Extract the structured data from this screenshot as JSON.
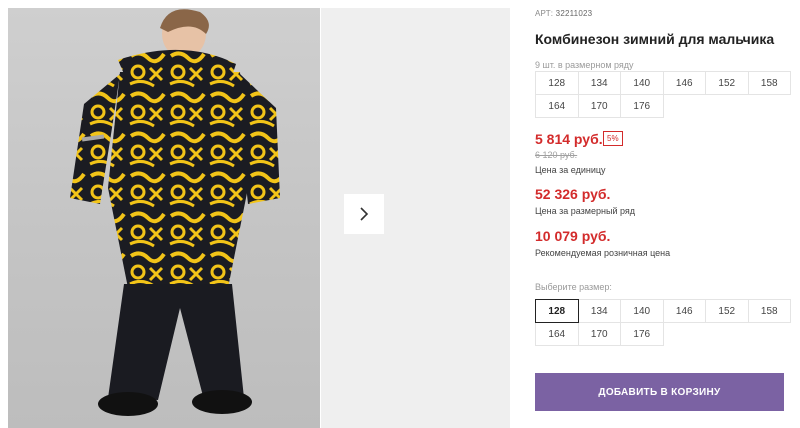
{
  "product": {
    "article_label": "АРТ:",
    "article_number": "32211023",
    "title": "Комбинезон зимний для мальчика",
    "row_count": "9 шт. в размерном ряду",
    "sizes_row": [
      "128",
      "134",
      "140",
      "146",
      "152",
      "158",
      "164",
      "170",
      "176"
    ],
    "price": "5 814 руб.",
    "discount": "5%",
    "old_price": "6 120 руб.",
    "price_label": "Цена за единицу",
    "row_price": "52 326 руб.",
    "row_price_label": "Цена за размерный ряд",
    "rrp_price": "10 079 руб.",
    "rrp_label": "Рекомендуемая розничная цена",
    "choose_size_label": "Выберите размер:",
    "selectable_sizes": [
      "128",
      "134",
      "140",
      "146",
      "152",
      "158",
      "164",
      "170",
      "176"
    ],
    "selected_size": "128",
    "add_to_cart": "ДОБАВИТЬ В КОРЗИНУ"
  },
  "gallery": {
    "next_icon": "chevron-right-icon",
    "photo": "boy-winter-jumpsuit-photo"
  },
  "colors": {
    "price_red": "#d32b2b",
    "button_purple": "#7b62a3",
    "jumpsuit_yellow": "#f2c418",
    "jumpsuit_black": "#1b1c22"
  }
}
